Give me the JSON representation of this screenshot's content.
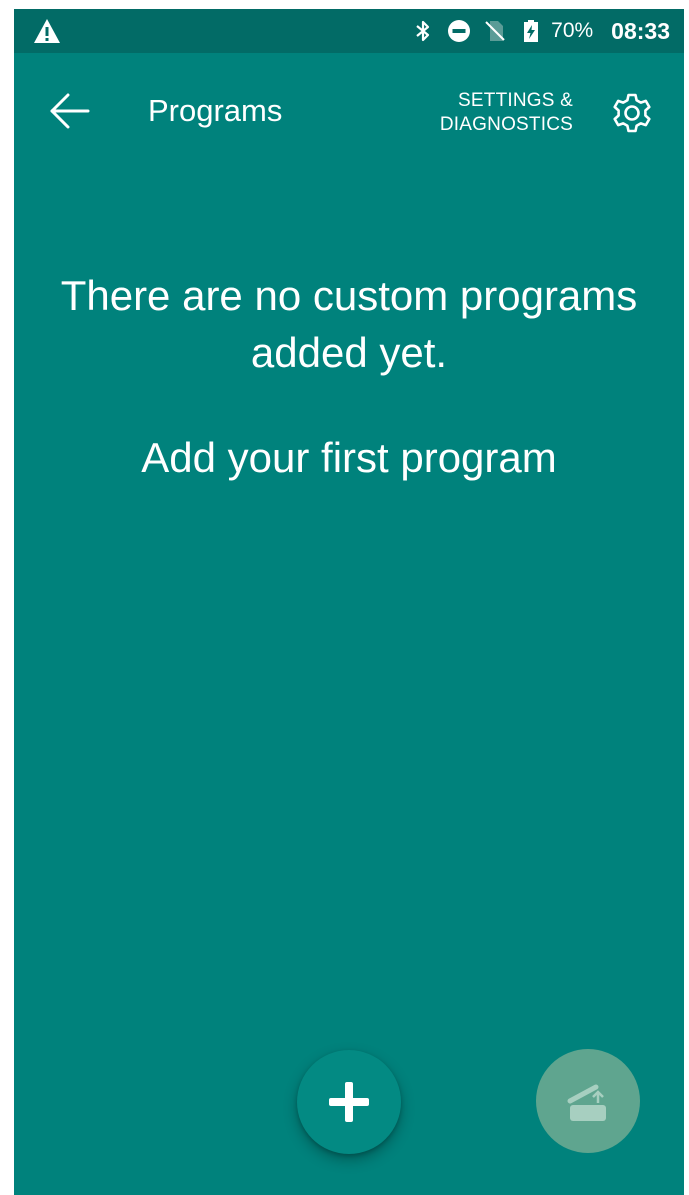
{
  "status_bar": {
    "left_icon": "warning-icon",
    "icons": [
      "bluetooth-icon",
      "do-not-disturb-icon",
      "no-sim-icon",
      "battery-charging-icon"
    ],
    "battery": "70%",
    "time": "08:33"
  },
  "app_bar": {
    "back_icon": "arrow-back-icon",
    "title": "Programs",
    "settings_line1": "SETTINGS &",
    "settings_line2": "DIAGNOSTICS",
    "settings_icon": "gear-icon"
  },
  "empty_state": {
    "line1": "There are no custom programs",
    "line2": "added yet.",
    "cta": "Add your first program"
  },
  "fabs": {
    "add_icon": "plus-icon",
    "upload_icon": "upload-program-icon"
  },
  "colors": {
    "background": "#00827c",
    "status_bar": "#026b66",
    "fab_add": "#038a83",
    "fab_upload": "#5fa58f",
    "text": "#ffffff"
  }
}
